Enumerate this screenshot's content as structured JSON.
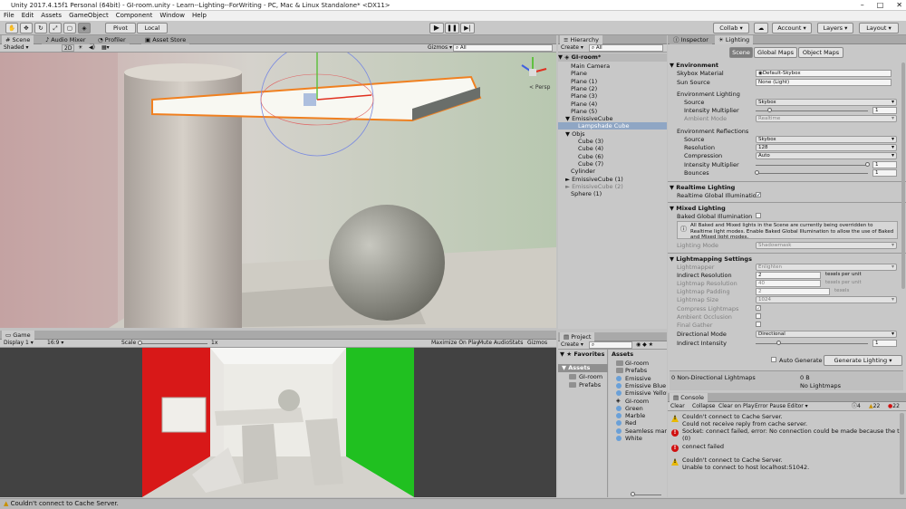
{
  "window": {
    "title": "Unity 2017.4.15f1 Personal (64bit) - GI-room.unity - Learn--Lighting--ForWriting - PC, Mac & Linux Standalone* <DX11>"
  },
  "menu": [
    "File",
    "Edit",
    "Assets",
    "GameObject",
    "Component",
    "Window",
    "Help"
  ],
  "toolbar": {
    "pivot": "Pivot",
    "local": "Local",
    "collab": "Collab",
    "account": "Account",
    "layers": "Layers",
    "layout": "Layout"
  },
  "scene": {
    "tabs": [
      "Scene",
      "Audio Mixer",
      "Profiler",
      "Asset Store"
    ],
    "shading": "Shaded",
    "mode2d": "2D",
    "gizmos": "Gizmos",
    "search": "All",
    "persp": "< Persp"
  },
  "game": {
    "tab": "Game",
    "display": "Display 1",
    "aspect": "16:9",
    "scale_label": "Scale",
    "scale_value": "1x",
    "buttons": [
      "Maximize On Play",
      "Mute Audio",
      "Stats",
      "Gizmos"
    ]
  },
  "hierarchy": {
    "tab": "Hierarchy",
    "create": "Create",
    "search": "All",
    "scene": "GI-room*",
    "items": [
      {
        "t": "Main Camera",
        "d": 1
      },
      {
        "t": "Plane",
        "d": 1
      },
      {
        "t": "Plane (1)",
        "d": 1
      },
      {
        "t": "Plane (2)",
        "d": 1
      },
      {
        "t": "Plane (3)",
        "d": 1
      },
      {
        "t": "Plane (4)",
        "d": 1
      },
      {
        "t": "Plane (5)",
        "d": 1
      },
      {
        "t": "EmissiveCube",
        "d": 1,
        "arrow": "▼"
      },
      {
        "t": "Lampshade Cube",
        "d": 2,
        "sel": true
      },
      {
        "t": "Objs",
        "d": 1,
        "arrow": "▼"
      },
      {
        "t": "Cube (3)",
        "d": 2
      },
      {
        "t": "Cube (4)",
        "d": 2
      },
      {
        "t": "Cube (6)",
        "d": 2
      },
      {
        "t": "Cube (7)",
        "d": 2
      },
      {
        "t": "Cylinder",
        "d": 1
      },
      {
        "t": "EmissiveCube (1)",
        "d": 1,
        "arrow": "►"
      },
      {
        "t": "EmissiveCube (2)",
        "d": 1,
        "arrow": "►",
        "dim": true
      },
      {
        "t": "Sphere (1)",
        "d": 1
      }
    ]
  },
  "project": {
    "tab": "Project",
    "create": "Create",
    "favorites": "Favorites",
    "assets_header": "Assets",
    "tree": [
      "Assets",
      "GI-room",
      "Prefabs"
    ],
    "assets": [
      {
        "t": "GI-room",
        "k": "folder"
      },
      {
        "t": "Prefabs",
        "k": "folder"
      },
      {
        "t": "Emissive",
        "k": "mat"
      },
      {
        "t": "Emissive Blue",
        "k": "mat"
      },
      {
        "t": "Emissive Yellow",
        "k": "mat"
      },
      {
        "t": "GI-room",
        "k": "unity"
      },
      {
        "t": "Green",
        "k": "mat"
      },
      {
        "t": "Marble",
        "k": "mat"
      },
      {
        "t": "Red",
        "k": "mat"
      },
      {
        "t": "Seamless marble",
        "k": "mat"
      },
      {
        "t": "White",
        "k": "mat"
      }
    ]
  },
  "lighting": {
    "tabs": [
      "Inspector",
      "Lighting"
    ],
    "subtabs": [
      "Scene",
      "Global Maps",
      "Object Maps"
    ],
    "environment": {
      "title": "Environment",
      "skybox_label": "Skybox Material",
      "skybox": "Default-Skybox",
      "sun_label": "Sun Source",
      "sun": "None (Light)",
      "env_lighting": "Environment Lighting",
      "source_label": "Source",
      "source": "Skybox",
      "intensity_label": "Intensity Multiplier",
      "intensity": "1",
      "ambient_label": "Ambient Mode",
      "ambient": "Realtime",
      "env_reflections": "Environment Reflections",
      "rsource": "Skybox",
      "resolution_label": "Resolution",
      "resolution": "128",
      "compression_label": "Compression",
      "compression": "Auto",
      "rintensity": "1",
      "bounces_label": "Bounces",
      "bounces": "1"
    },
    "realtime": {
      "title": "Realtime Lighting",
      "gi_label": "Realtime Global Illumination"
    },
    "mixed": {
      "title": "Mixed Lighting",
      "baked_label": "Baked Global Illumination",
      "info": "All Baked and Mixed lights in the Scene are currently being overridden to Realtime light modes. Enable Baked Global Illumination to allow the use of Baked and Mixed light modes.",
      "mode_label": "Lighting Mode",
      "mode": "Shadowmask"
    },
    "lightmapping": {
      "title": "Lightmapping Settings",
      "lightmapper_label": "Lightmapper",
      "lightmapper": "Enlighten",
      "indirect_res_label": "Indirect Resolution",
      "indirect_res": "2",
      "texels": "texels per unit",
      "lightmap_res_label": "Lightmap Resolution",
      "lightmap_res": "40",
      "padding_label": "Lightmap Padding",
      "padding": "2",
      "texels2": "texels",
      "size_label": "Lightmap Size",
      "size": "1024",
      "compress_label": "Compress Lightmaps",
      "ao_label": "Ambient Occlusion",
      "fg_label": "Final Gather",
      "dir_label": "Directional Mode",
      "dir": "Directional",
      "ind_int_label": "Indirect Intensity",
      "ind_int": "1"
    },
    "auto_generate": "Auto Generate",
    "generate": "Generate Lighting",
    "nonlm": "0 Non-Directional Lightmaps",
    "bytes": "0 B",
    "nolm": "No Lightmaps"
  },
  "console": {
    "tab": "Console",
    "buttons": [
      "Clear",
      "Collapse",
      "Clear on Play",
      "Error Pause",
      "Editor"
    ],
    "counts": {
      "info": "4",
      "warn": "22",
      "err": "22"
    },
    "logs": [
      {
        "k": "warn",
        "l1": "Couldn't connect to Cache Server.",
        "l2": "Could not receive reply from cache server."
      },
      {
        "k": "err",
        "l1": "Socket: connect failed, error: No connection could be made because the target r",
        "l2": "(0)"
      },
      {
        "k": "err",
        "l1": "connect failed",
        "l2": ""
      },
      {
        "k": "warn",
        "l1": "Couldn't connect to Cache Server.",
        "l2": "Unable to connect to host localhost:51042."
      }
    ]
  },
  "statusbar": "Couldn't connect to Cache Server."
}
